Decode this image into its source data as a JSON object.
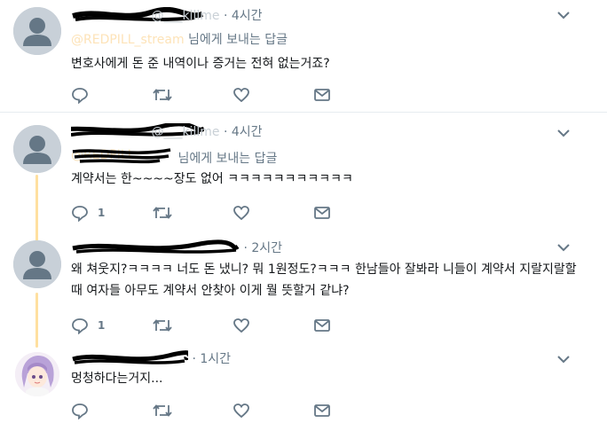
{
  "tweets": [
    {
      "name": "",
      "handle": "@___killme",
      "time": "4시간",
      "reply_to_user": "@REDPILL_stream",
      "reply_suffix": "님에게 보내는 답글",
      "text": "변호사에게 돈 준 내역이나 증거는 전혀 없는거죠?",
      "reply_count": "",
      "retweet_count": "",
      "like_count": ""
    },
    {
      "name": "",
      "handle": "@___killme",
      "time": "4시간",
      "reply_to_user": "@REDPILL_",
      "reply_suffix": "님에게 보내는 답글",
      "text": "계약서는 한~~~~장도 없어 ㅋㅋㅋㅋㅋㅋㅋㅋㅋㅋㅋ",
      "reply_count": "1",
      "retweet_count": "",
      "like_count": ""
    },
    {
      "name": "",
      "handle": "",
      "time": "2시간",
      "reply_to_user": "",
      "reply_suffix": "",
      "text": "왜 쳐웃지?ㅋㅋㅋㅋ 너도 돈 냈니? 뭐 1원정도?ㅋㅋㅋ 한남들아 잘봐라 니들이 계약서 지랄지랄할 때 여자들 아무도 계약서 안찾아 이게 뭘 뜻할거 같냐?",
      "reply_count": "1",
      "retweet_count": "",
      "like_count": ""
    },
    {
      "name": "",
      "handle": "",
      "time": "1시간",
      "reply_to_user": "",
      "reply_suffix": "",
      "text": "멍청하다는거지...",
      "reply_count": "",
      "retweet_count": "",
      "like_count": ""
    }
  ],
  "icons": {
    "reply": "reply-icon",
    "retweet": "retweet-icon",
    "like": "heart-icon",
    "dm": "envelope-icon",
    "more": "chevron-down-icon"
  },
  "colors": {
    "accent": "#f5a623",
    "icon": "#657786",
    "thread_line": "#ffe0a0",
    "divider": "#e6ecf0"
  }
}
